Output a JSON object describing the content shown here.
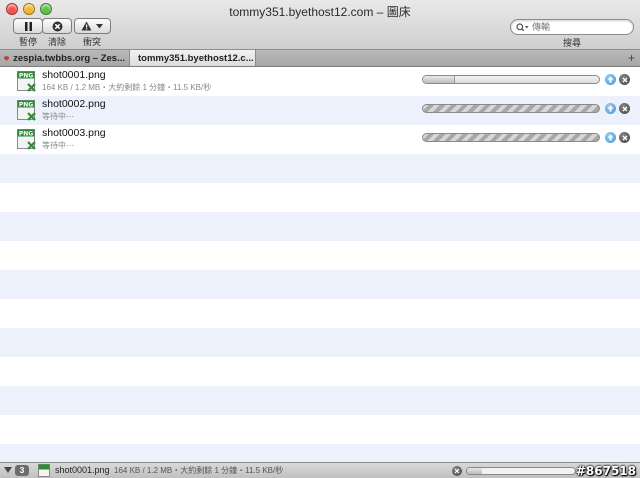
{
  "window": {
    "title": "tommy351.byethost12.com – 圖床",
    "lights": {
      "close": "#f2544a",
      "minimize": "#f2b630",
      "zoom": "#60c04a"
    }
  },
  "toolbar": {
    "pause_label": "暫停",
    "clear_label": "清除",
    "conflict_label": "衝突",
    "search_placeholder": "傳輸",
    "search_label": "搜尋"
  },
  "tabs": [
    {
      "label": "zespia.twbbs.org – Zes...",
      "icon": "heart-icon",
      "active": false
    },
    {
      "label": "tommy351.byethost12.c...",
      "icon": "page-icon",
      "active": true
    }
  ],
  "downloads": [
    {
      "name": "shot0001.png",
      "status": "164 KB / 1.2 MB・大約剩餘 1 分鐘・11.5 KB/秒",
      "progress": 0.18,
      "waiting": false
    },
    {
      "name": "shot0002.png",
      "status": "等待中⋯",
      "progress": 0,
      "waiting": true
    },
    {
      "name": "shot0003.png",
      "status": "等待中⋯",
      "progress": 0,
      "waiting": true
    }
  ],
  "statusbar": {
    "count": "3",
    "file": "shot0001.png",
    "info": "164 KB / 1.2 MB・大約剩餘 1 分鐘・11.5 KB/秒",
    "progress": 0.14,
    "watermark": "#867518"
  },
  "colors": {
    "png_badge": "#2e8b3a",
    "upload_button": "#3f8fd0"
  }
}
